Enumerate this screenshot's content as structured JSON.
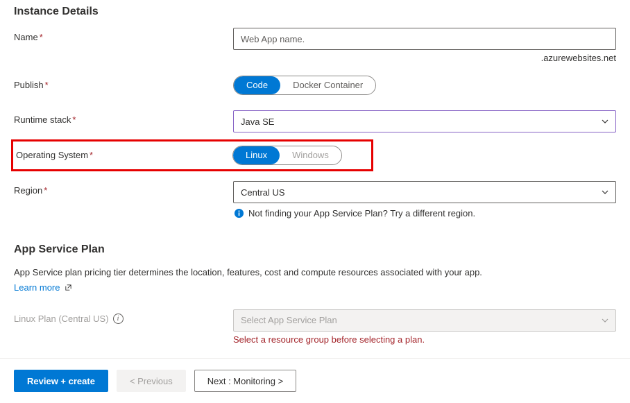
{
  "section1": {
    "title": "Instance Details",
    "name_label": "Name",
    "name_placeholder": "Web App name.",
    "name_suffix": ".azurewebsites.net",
    "publish_label": "Publish",
    "publish_options": {
      "code": "Code",
      "docker": "Docker Container"
    },
    "runtime_label": "Runtime stack",
    "runtime_value": "Java SE",
    "os_label": "Operating System",
    "os_options": {
      "linux": "Linux",
      "windows": "Windows"
    },
    "region_label": "Region",
    "region_value": "Central US",
    "region_hint": "Not finding your App Service Plan? Try a different region."
  },
  "section2": {
    "title": "App Service Plan",
    "desc": "App Service plan pricing tier determines the location, features, cost and compute resources associated with your app.",
    "learn_more": "Learn more",
    "plan_label": "Linux Plan (Central US)",
    "plan_placeholder": "Select App Service Plan",
    "plan_error": "Select a resource group before selecting a plan."
  },
  "footer": {
    "review": "Review + create",
    "previous": "< Previous",
    "next": "Next : Monitoring >"
  }
}
